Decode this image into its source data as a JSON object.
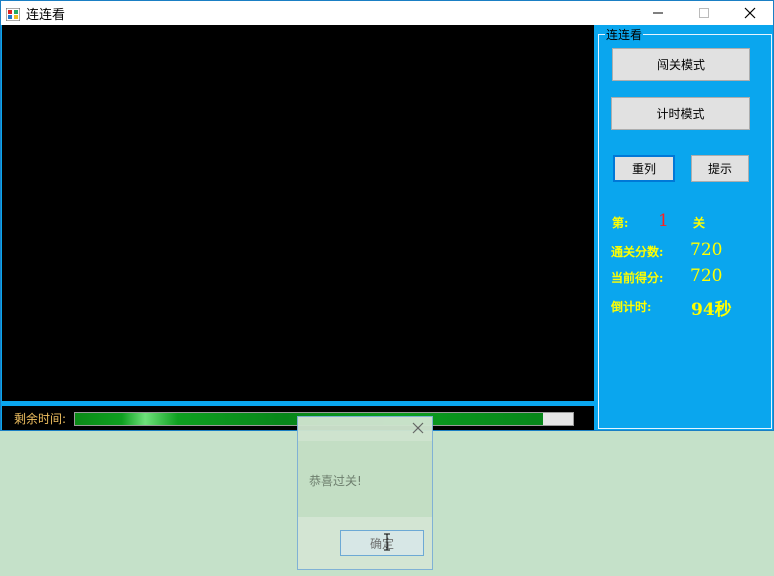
{
  "window": {
    "title": "连连看",
    "icon": "app-grid-icon"
  },
  "titlebar_buttons": {
    "minimize_icon": "minimize-icon",
    "maximize_icon": "maximize-icon",
    "close_icon": "close-icon"
  },
  "status": {
    "time_label": "剩余时间:",
    "time_remaining_fraction": 0.94
  },
  "panel": {
    "group_title": "连连看",
    "level_mode_label": "闯关模式",
    "timed_mode_label": "计时模式",
    "shuffle_label": "重列",
    "hint_label": "提示",
    "level_label": "第:",
    "level_value": "1",
    "level_suffix": "关",
    "pass_score_label": "通关分数:",
    "pass_score_value": "720",
    "current_score_label": "当前得分:",
    "current_score_value": "720",
    "countdown_label": "倒计时:",
    "countdown_value": "94秒"
  },
  "dialog": {
    "message": "恭喜过关!",
    "ok_label": "确定",
    "close_icon": "close-icon"
  },
  "colors": {
    "panel_bg": "#0aa6ee",
    "label_yellow": "#ffff00",
    "level_red": "#ff2020",
    "progress_green": "#0a9b1f",
    "desktop_bg": "#c5e1c9"
  }
}
